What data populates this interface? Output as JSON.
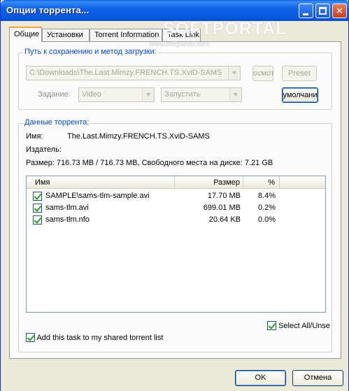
{
  "window": {
    "title": "Опции торрента..."
  },
  "tabs": [
    {
      "label": "Общие",
      "active": true
    },
    {
      "label": "Установки"
    },
    {
      "label": "Torrent Information"
    },
    {
      "label": "Task Link"
    }
  ],
  "watermark": {
    "text": "SOFTPORTAL",
    "url": "www.softportal.com"
  },
  "save_group": {
    "title": "Путь к сохранению и метод загрузки:",
    "path_value": "C:\\Downloads\\The.Last.Mimzy.FRENCH.TS.XviD-SAMS",
    "browse_label": "восмотр",
    "browse_label_visible": "осмот",
    "preset_label": "Preset",
    "task_label": "Задание:",
    "category_value": "Video",
    "action_value": "Запустить",
    "default_label": "умолчани"
  },
  "torrent_group": {
    "title": "Данные торрента:",
    "name_label": "Имя:",
    "name_value": "The.Last.Mimzy.FRENCH.TS.XviD-SAMS",
    "publisher_label": "Издатель:",
    "size_line": "Размер: 716.73 MB / 716.73 MB, Свободного места на диске: 7.21 GB"
  },
  "files_table": {
    "columns": [
      "Имя",
      "Размер",
      "%"
    ],
    "rows": [
      {
        "name": "SAMPLE\\sams-tlm-sample.avi",
        "size": "17.70 MB",
        "percent": "8.4%",
        "checked": true
      },
      {
        "name": "sams-tlm.avi",
        "size": "699.01 MB",
        "percent": "0.2%",
        "checked": true
      },
      {
        "name": "sams-tlm.nfo",
        "size": "20.64 KB",
        "percent": "0.0%",
        "checked": true
      }
    ]
  },
  "select_all": {
    "label": "Select All/Unse",
    "checked": true
  },
  "share": {
    "label": "Add this task to my shared torrent list",
    "checked": true
  },
  "buttons": {
    "ok": "OK",
    "cancel": "Отмена"
  },
  "colors": {
    "titlebar": "#0a5ee6",
    "group_title": "#0046d5",
    "tab_highlight": "#f1a23b",
    "check": "#21a121"
  }
}
